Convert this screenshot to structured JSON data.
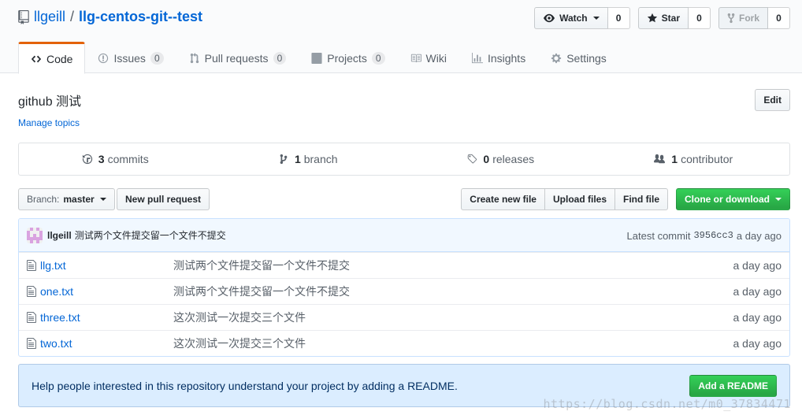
{
  "repo": {
    "owner": "llgeill",
    "separator": "/",
    "name": "llg-centos-git--test"
  },
  "actions": {
    "watch_label": "Watch",
    "watch_count": "0",
    "star_label": "Star",
    "star_count": "0",
    "fork_label": "Fork",
    "fork_count": "0"
  },
  "nav": {
    "code": "Code",
    "issues": "Issues",
    "issues_count": "0",
    "pulls": "Pull requests",
    "pulls_count": "0",
    "projects": "Projects",
    "projects_count": "0",
    "wiki": "Wiki",
    "insights": "Insights",
    "settings": "Settings"
  },
  "description": "github 测试",
  "manage_topics": "Manage topics",
  "edit_label": "Edit",
  "numbers": {
    "commits_count": "3",
    "commits_label": "commits",
    "branch_count": "1",
    "branch_label": "branch",
    "releases_count": "0",
    "releases_label": "releases",
    "contributors_count": "1",
    "contributors_label": "contributor"
  },
  "file_nav": {
    "branch_prefix": "Branch:",
    "branch_name": "master",
    "new_pull_request": "New pull request",
    "create_new_file": "Create new file",
    "upload_files": "Upload files",
    "find_file": "Find file",
    "clone_or_download": "Clone or download"
  },
  "latest_commit": {
    "author": "llgeill",
    "message": "测试两个文件提交留一个文件不提交",
    "prefix": "Latest commit",
    "sha": "3956cc3",
    "age": "a day ago"
  },
  "files": [
    {
      "name": "llg.txt",
      "message": "测试两个文件提交留一个文件不提交",
      "age": "a day ago"
    },
    {
      "name": "one.txt",
      "message": "测试两个文件提交留一个文件不提交",
      "age": "a day ago"
    },
    {
      "name": "three.txt",
      "message": "这次测试一次提交三个文件",
      "age": "a day ago"
    },
    {
      "name": "two.txt",
      "message": "这次测试一次提交三个文件",
      "age": "a day ago"
    }
  ],
  "readme_prompt": {
    "text": "Help people interested in this repository understand your project by adding a README.",
    "button": "Add a README"
  },
  "watermark": "https://blog.csdn.net/m0_37834471",
  "colors": {
    "accent": "#0366d6",
    "green": "#28a745",
    "tab_highlight": "#e36209",
    "info_bg": "#dbedff"
  }
}
